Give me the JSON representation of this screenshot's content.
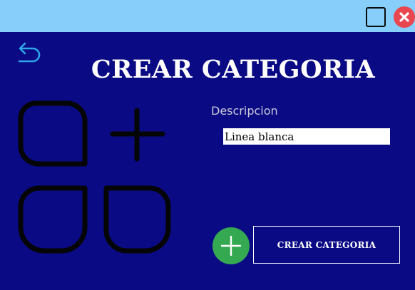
{
  "window": {
    "maximize_icon": "square-outline-icon",
    "close_icon": "close-circle-icon",
    "title_bar_color": "#87cefa",
    "background_color": "#0a0a85"
  },
  "header": {
    "back_icon": "undo-arrow-icon",
    "title": "CREAR CATEGORIA"
  },
  "form": {
    "illustration_icon": "category-add-icon",
    "description_label": "Descripcion",
    "description_value": "Linea blanca",
    "add_icon": "plus-circle-icon",
    "add_color": "#35a852",
    "submit_label": "CREAR CATEGORIA"
  }
}
